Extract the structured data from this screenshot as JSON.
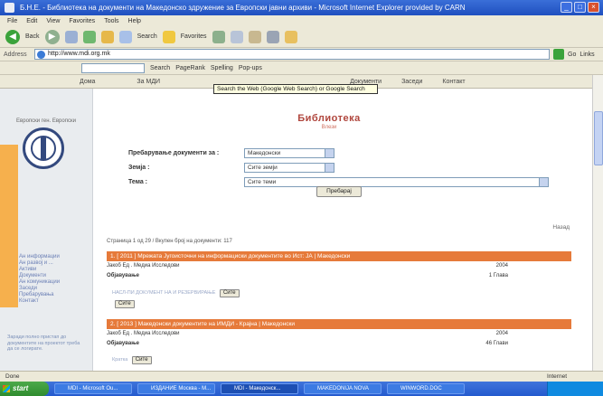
{
  "window": {
    "title": "Б.Н.Е. - Библиотека на документи на Македонско здружение за Европски јавни архиви - Microsoft Internet Explorer provided by CARN"
  },
  "menubar": [
    "File",
    "Edit",
    "View",
    "Favorites",
    "Tools",
    "Help"
  ],
  "toolbar": {
    "back_label": "Back",
    "search_label": "Search",
    "favorites_label": "Favorites"
  },
  "address": {
    "label": "Address",
    "url": "http://www.mdi.org.mk",
    "go_label": "Go",
    "links_label": "Links"
  },
  "googlebar": {
    "search_label": "Search",
    "pagerank_label": "PageRank",
    "spelling_label": "Spelling",
    "popups_label": "Pop-ups"
  },
  "sitenav": [
    "Дома",
    "За МДИ",
    "Документи",
    "Заседи",
    "Контакт"
  ],
  "tooltip": "Search the Web (Google Web Search) or Google Search",
  "sidebar": {
    "top_text": "Европски ген. Европски",
    "menu": [
      "Ан информации",
      "Ан развој и ...",
      "Активи",
      "Документи",
      "Ан комуникации",
      "Заседи",
      "Пребарувања",
      "Контакт"
    ],
    "paragraph": "Заради полно пристап до документите на проектот треба да се логирате."
  },
  "main": {
    "heading": "Библиотека",
    "subheading": "Влези",
    "form": [
      {
        "label": "Пребарување документи за :",
        "value": "Македонски"
      },
      {
        "label": "Земја :",
        "value": "Сите земји"
      },
      {
        "label": "Тема :",
        "value": "Сите теми"
      }
    ],
    "search_button": "Пребарај",
    "back_link": "Назад",
    "pager": "Страница 1 од 29 / Вкупен број на документи: 117",
    "results": [
      {
        "header": "1. [ 2011 ] Мрежата Југоисточни на информациски документите во Ист: ЈА | Македонски",
        "author": "Јакоб Ед . Медиа Исследови",
        "year": "2004",
        "pages_label": "Објавување",
        "pages": "1 Глава",
        "meta": "НАСЛ-ПИ ДОКУМЕНТ НА И РЕЗЕРВИРАЊЕ",
        "btn1": "Сите",
        "btn2": "Сите"
      },
      {
        "header": "2. [ 2013 ] Македонски документите на ИМДИ - Крајна | Македонски",
        "author": "Јакоб Ед . Медиа Исследови",
        "year": "2004",
        "pages_label": "Објавување",
        "pages": "46 Глави",
        "meta": "Кратка",
        "btn1": "Сите"
      }
    ]
  },
  "statusbar": {
    "text": "Done",
    "zone": "Internet"
  },
  "taskbar": {
    "start": "start",
    "tasks": [
      "MDI - Microsoft Ou...",
      "ИЗДАНИЕ Москва - M...",
      "MDI - Македонск...",
      "MAKEDONIJA NOVA",
      "WINWORD.DOC"
    ]
  }
}
